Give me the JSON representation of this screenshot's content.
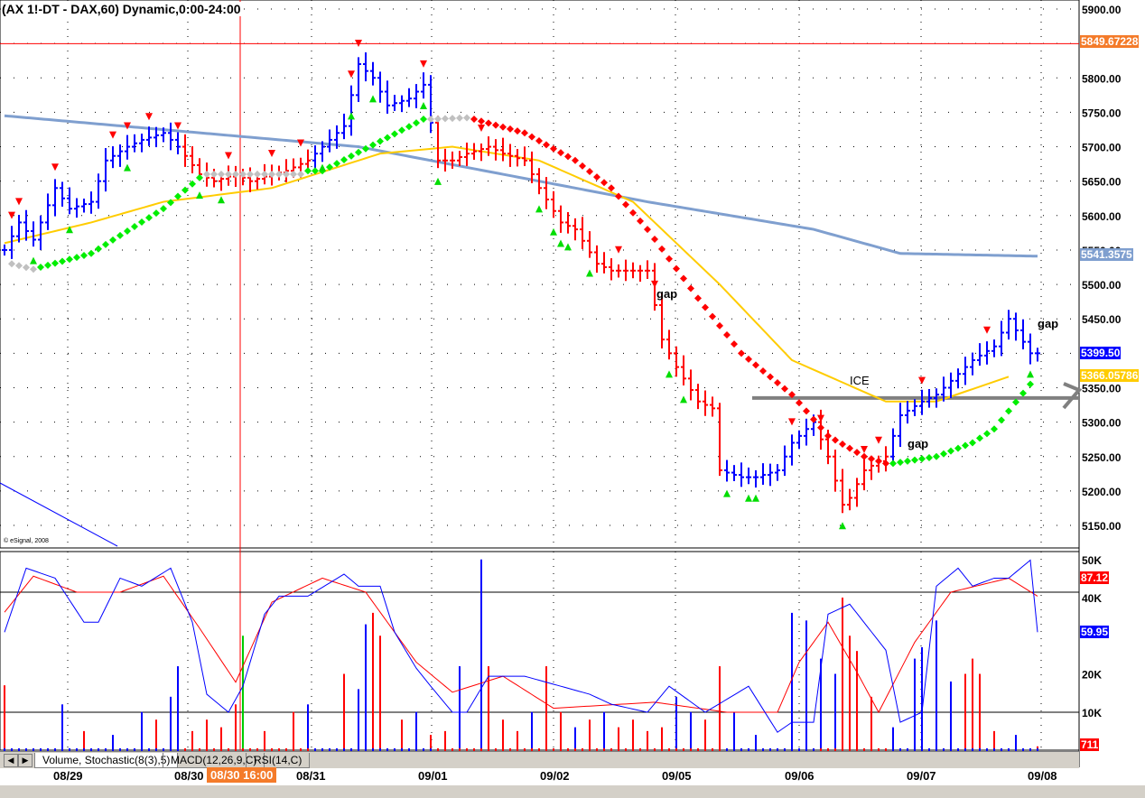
{
  "title": "(AX 1!-DT  - DAX,60) Dynamic,0:00-24:00",
  "copyright": "© eSignal, 2008",
  "tabs": [
    "Volume, Stochastic(8(3),5)",
    "MACD(12,26,9,C)",
    "RSI(14,C)"
  ],
  "dates": [
    "08/29",
    "08/30",
    "08/31",
    "09/01",
    "09/02",
    "09/05",
    "09/06",
    "09/07",
    "09/08"
  ],
  "cursor_date": "08/30 16:00",
  "annotations": {
    "gap1": "gap",
    "gap2": "gap",
    "gap3": "gap",
    "ice": "ICE"
  },
  "colors": {
    "up": "#0000ff",
    "down": "#ff0000",
    "ma_slow": "#7f9fcf",
    "ma_fast": "#ffcc00",
    "dot_up": "#00ee00",
    "dot_down": "#ff0000",
    "dot_neutral": "#c0c0c0",
    "cursor_tag": "#f47b2a"
  },
  "chart_data": [
    {
      "type": "ohlc",
      "title": "DAX 60 min",
      "ylim": [
        5130,
        5910
      ],
      "price_ticks": [
        "5900.00",
        "5850.00",
        "5800.00",
        "5750.00",
        "5700.00",
        "5650.00",
        "5600.00",
        "5550.00",
        "5500.00",
        "5450.00",
        "5400.00",
        "5350.00",
        "5300.00",
        "5250.00",
        "5200.00",
        "5150.00"
      ],
      "price_tick_values": [
        5900,
        5850,
        5800,
        5750,
        5700,
        5650,
        5600,
        5550,
        5500,
        5450,
        5400,
        5350,
        5300,
        5250,
        5200,
        5150
      ],
      "tags": {
        "ref_line": "5849.67228",
        "ma_slow": "5541.3575",
        "last": "5399.50",
        "ma_fast": "5366.05786"
      },
      "ref_line_value": 5849.67,
      "ice_level": 5335,
      "close_keypoints": [
        [
          0,
          5550
        ],
        [
          2,
          5590
        ],
        [
          4,
          5565
        ],
        [
          7,
          5640
        ],
        [
          9,
          5610
        ],
        [
          12,
          5620
        ],
        [
          14,
          5680
        ],
        [
          17,
          5700
        ],
        [
          19,
          5710
        ],
        [
          22,
          5720
        ],
        [
          24,
          5700
        ],
        [
          27,
          5660
        ],
        [
          29,
          5650
        ],
        [
          32,
          5660
        ],
        [
          34,
          5650
        ],
        [
          37,
          5660
        ],
        [
          39,
          5665
        ],
        [
          42,
          5680
        ],
        [
          44,
          5700
        ],
        [
          47,
          5730
        ],
        [
          49,
          5820
        ],
        [
          51,
          5800
        ],
        [
          53,
          5760
        ],
        [
          56,
          5770
        ],
        [
          58,
          5790
        ],
        [
          60,
          5680
        ],
        [
          62,
          5680
        ],
        [
          64,
          5690
        ],
        [
          67,
          5700
        ],
        [
          69,
          5690
        ],
        [
          72,
          5680
        ],
        [
          74,
          5640
        ],
        [
          77,
          5590
        ],
        [
          79,
          5580
        ],
        [
          82,
          5530
        ],
        [
          84,
          5520
        ],
        [
          87,
          5520
        ],
        [
          89,
          5520
        ],
        [
          91,
          5420
        ],
        [
          93,
          5380
        ],
        [
          96,
          5330
        ],
        [
          98,
          5320
        ],
        [
          99,
          5230
        ],
        [
          102,
          5220
        ],
        [
          104,
          5220
        ],
        [
          107,
          5230
        ],
        [
          109,
          5270
        ],
        [
          112,
          5300
        ],
        [
          114,
          5250
        ],
        [
          116,
          5180
        ],
        [
          117,
          5190
        ],
        [
          119,
          5230
        ],
        [
          122,
          5250
        ],
        [
          124,
          5310
        ],
        [
          127,
          5330
        ],
        [
          129,
          5340
        ],
        [
          132,
          5370
        ],
        [
          134,
          5390
        ],
        [
          137,
          5410
        ],
        [
          139,
          5450
        ],
        [
          142,
          5400
        ],
        [
          143,
          5400
        ]
      ],
      "down_ranges": [
        [
          25,
          42
        ],
        [
          60,
          99
        ],
        [
          113,
          122
        ]
      ],
      "ma_slow": [
        [
          0,
          5745
        ],
        [
          49,
          5700
        ],
        [
          79,
          5640
        ],
        [
          89,
          5620
        ],
        [
          112,
          5580
        ],
        [
          124,
          5545
        ],
        [
          143,
          5541
        ]
      ],
      "ma_fast": [
        [
          0,
          5560
        ],
        [
          12,
          5590
        ],
        [
          22,
          5620
        ],
        [
          37,
          5640
        ],
        [
          52,
          5690
        ],
        [
          62,
          5700
        ],
        [
          74,
          5680
        ],
        [
          87,
          5620
        ],
        [
          99,
          5500
        ],
        [
          109,
          5390
        ],
        [
          122,
          5330
        ],
        [
          129,
          5330
        ],
        [
          139,
          5366
        ]
      ],
      "dots": [
        {
          "kind": "neutral",
          "pts": [
            [
              1,
              5530
            ],
            [
              4,
              5522
            ]
          ]
        },
        {
          "kind": "up",
          "pts": [
            [
              5,
              5525
            ],
            [
              12,
              5545
            ],
            [
              22,
              5610
            ],
            [
              27,
              5655
            ]
          ]
        },
        {
          "kind": "neutral",
          "pts": [
            [
              28,
              5660
            ],
            [
              41,
              5660
            ]
          ]
        },
        {
          "kind": "up",
          "pts": [
            [
              42,
              5665
            ],
            [
              44,
              5665
            ],
            [
              58,
              5740
            ]
          ]
        },
        {
          "kind": "neutral",
          "pts": [
            [
              59,
              5740
            ],
            [
              64,
              5742
            ]
          ]
        },
        {
          "kind": "down",
          "pts": [
            [
              65,
              5740
            ],
            [
              72,
              5720
            ],
            [
              79,
              5680
            ],
            [
              84,
              5640
            ],
            [
              89,
              5580
            ],
            [
              96,
              5480
            ],
            [
              102,
              5400
            ],
            [
              109,
              5340
            ],
            [
              114,
              5280
            ],
            [
              119,
              5250
            ],
            [
              122,
              5240
            ]
          ]
        },
        {
          "kind": "up",
          "pts": [
            [
              123,
              5240
            ],
            [
              129,
              5250
            ],
            [
              134,
              5270
            ],
            [
              137,
              5290
            ],
            [
              142,
              5355
            ]
          ]
        }
      ],
      "sell_markers": [
        1,
        2,
        7,
        15,
        17,
        20,
        24,
        31,
        37,
        41,
        48,
        49,
        58,
        66,
        85,
        90,
        109,
        113,
        119,
        121,
        127,
        136
      ],
      "buy_markers": [
        4,
        9,
        17,
        27,
        30,
        44,
        48,
        51,
        58,
        60,
        74,
        76,
        77,
        78,
        81,
        92,
        94,
        100,
        103,
        104,
        116,
        142
      ]
    },
    {
      "type": "volume_stochastic",
      "title": "Volume, Stochastic(8(3),5)",
      "volume_ticks": [
        "50K",
        "40K",
        "20K",
        "10K"
      ],
      "volume_tick_values": [
        50,
        40,
        20,
        10
      ],
      "tags": {
        "d": "87.12",
        "k": "59.95",
        "volume": "711"
      },
      "stoch_levels": [
        80,
        20
      ],
      "volume": [
        [
          0,
          17,
          "r"
        ],
        [
          8,
          12,
          "b"
        ],
        [
          11,
          5,
          "r"
        ],
        [
          15,
          4,
          "b"
        ],
        [
          19,
          10,
          "b"
        ],
        [
          21,
          8,
          "r"
        ],
        [
          23,
          14,
          "b"
        ],
        [
          24,
          22,
          "b"
        ],
        [
          26,
          5,
          "r"
        ],
        [
          28,
          8,
          "r"
        ],
        [
          30,
          6,
          "r"
        ],
        [
          32,
          12,
          "r"
        ],
        [
          33,
          30,
          "g"
        ],
        [
          36,
          5,
          "r"
        ],
        [
          40,
          10,
          "r"
        ],
        [
          42,
          12,
          "b"
        ],
        [
          47,
          20,
          "r"
        ],
        [
          49,
          16,
          "b"
        ],
        [
          50,
          33,
          "b"
        ],
        [
          51,
          36,
          "r"
        ],
        [
          52,
          30,
          "r"
        ],
        [
          55,
          8,
          "r"
        ],
        [
          57,
          10,
          "b"
        ],
        [
          59,
          4,
          "r"
        ],
        [
          61,
          5,
          "r"
        ],
        [
          63,
          22,
          "b"
        ],
        [
          66,
          50,
          "b"
        ],
        [
          67,
          22,
          "r"
        ],
        [
          69,
          8,
          "r"
        ],
        [
          71,
          5,
          "r"
        ],
        [
          73,
          10,
          "b"
        ],
        [
          75,
          22,
          "r"
        ],
        [
          77,
          10,
          "r"
        ],
        [
          79,
          6,
          "b"
        ],
        [
          81,
          8,
          "r"
        ],
        [
          83,
          10,
          "b"
        ],
        [
          85,
          6,
          "r"
        ],
        [
          87,
          8,
          "r"
        ],
        [
          89,
          5,
          "r"
        ],
        [
          91,
          6,
          "r"
        ],
        [
          93,
          14,
          "b"
        ],
        [
          95,
          10,
          "b"
        ],
        [
          97,
          8,
          "r"
        ],
        [
          99,
          22,
          "r"
        ],
        [
          101,
          10,
          "b"
        ],
        [
          104,
          4,
          "b"
        ],
        [
          109,
          36,
          "b"
        ],
        [
          111,
          34,
          "b"
        ],
        [
          113,
          24,
          "b"
        ],
        [
          115,
          20,
          "b"
        ],
        [
          116,
          40,
          "r"
        ],
        [
          117,
          30,
          "r"
        ],
        [
          118,
          26,
          "r"
        ],
        [
          120,
          14,
          "r"
        ],
        [
          123,
          6,
          "b"
        ],
        [
          126,
          24,
          "b"
        ],
        [
          127,
          27,
          "b"
        ],
        [
          129,
          34,
          "b"
        ],
        [
          131,
          18,
          "b"
        ],
        [
          133,
          20,
          "r"
        ],
        [
          134,
          24,
          "r"
        ],
        [
          135,
          20,
          "r"
        ],
        [
          137,
          5,
          "r"
        ],
        [
          140,
          4,
          "b"
        ],
        [
          143,
          1,
          "r"
        ]
      ],
      "stoch_k": [
        [
          0,
          60
        ],
        [
          3,
          92
        ],
        [
          7,
          87
        ],
        [
          11,
          65
        ],
        [
          13,
          65
        ],
        [
          16,
          87
        ],
        [
          19,
          83
        ],
        [
          23,
          92
        ],
        [
          26,
          65
        ],
        [
          28,
          29
        ],
        [
          31,
          20
        ],
        [
          33,
          33
        ],
        [
          36,
          69
        ],
        [
          38,
          78
        ],
        [
          42,
          78
        ],
        [
          47,
          89
        ],
        [
          49,
          83
        ],
        [
          52,
          83
        ],
        [
          54,
          60
        ],
        [
          57,
          42
        ],
        [
          59,
          33
        ],
        [
          62,
          20
        ],
        [
          64,
          20
        ],
        [
          67,
          38
        ],
        [
          72,
          38
        ],
        [
          77,
          33
        ],
        [
          81,
          29
        ],
        [
          84,
          24
        ],
        [
          89,
          20
        ],
        [
          92,
          33
        ],
        [
          97,
          20
        ],
        [
          103,
          33
        ],
        [
          107,
          10
        ],
        [
          109,
          15
        ],
        [
          112,
          15
        ],
        [
          114,
          69
        ],
        [
          117,
          74
        ],
        [
          122,
          51
        ],
        [
          124,
          15
        ],
        [
          127,
          20
        ],
        [
          129,
          83
        ],
        [
          132,
          92
        ],
        [
          134,
          83
        ],
        [
          137,
          87
        ],
        [
          139,
          87
        ],
        [
          142,
          96
        ],
        [
          143,
          60
        ]
      ],
      "stoch_d": [
        [
          0,
          70
        ],
        [
          4,
          88
        ],
        [
          10,
          80
        ],
        [
          16,
          80
        ],
        [
          22,
          88
        ],
        [
          27,
          62
        ],
        [
          32,
          35
        ],
        [
          37,
          75
        ],
        [
          44,
          87
        ],
        [
          50,
          80
        ],
        [
          57,
          45
        ],
        [
          62,
          30
        ],
        [
          69,
          38
        ],
        [
          76,
          22
        ],
        [
          90,
          25
        ],
        [
          100,
          20
        ],
        [
          107,
          20
        ],
        [
          110,
          45
        ],
        [
          114,
          65
        ],
        [
          118,
          40
        ],
        [
          121,
          20
        ],
        [
          126,
          55
        ],
        [
          131,
          80
        ],
        [
          139,
          87
        ],
        [
          143,
          78
        ]
      ]
    }
  ]
}
